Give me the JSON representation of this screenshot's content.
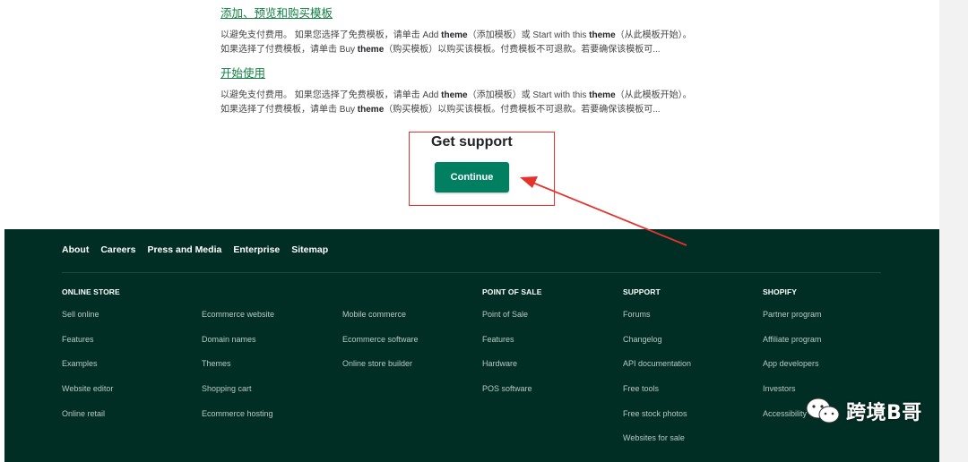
{
  "articles": [
    {
      "link": "添加、预览和购买模板",
      "line1_pre": "以避免支付费用。 如果您选择了免费模板，请单击 Add ",
      "line1_bold1": "theme",
      "line1_mid": "（添加模板）或 Start with this ",
      "line1_bold2": "theme",
      "line1_post": "（从此模板开始）。",
      "line2_pre": "如果选择了付费模板，请单击 Buy ",
      "line2_bold": "theme",
      "line2_post": "（购买模板）以购买该模板。付费模板不可退款。若要确保该模板可..."
    },
    {
      "link": "开始使用",
      "line1_pre": "以避免支付费用。 如果您选择了免费模板，请单击 Add ",
      "line1_bold1": "theme",
      "line1_mid": "（添加模板）或 Start with this ",
      "line1_bold2": "theme",
      "line1_post": "（从此模板开始）。",
      "line2_pre": "如果选择了付费模板，请单击 Buy ",
      "line2_bold": "theme",
      "line2_post": "（购买模板）以购买该模板。付费模板不可退款。若要确保该模板可..."
    }
  ],
  "support": {
    "title": "Get support",
    "button": "Continue"
  },
  "footer": {
    "top_links": [
      "About",
      "Careers",
      "Press and Media",
      "Enterprise",
      "Sitemap"
    ],
    "columns": [
      {
        "heading": "ONLINE STORE",
        "items": [
          "Sell online",
          "Features",
          "Examples",
          "Website editor",
          "Online retail"
        ]
      },
      {
        "heading": "",
        "items": [
          "Ecommerce website",
          "Domain names",
          "Themes",
          "Shopping cart",
          "Ecommerce hosting"
        ]
      },
      {
        "heading": "",
        "items": [
          "Mobile commerce",
          "Ecommerce software",
          "Online store builder"
        ]
      },
      {
        "heading": "POINT OF SALE",
        "items": [
          "Point of Sale",
          "Features",
          "Hardware",
          "POS software"
        ]
      },
      {
        "heading": "SUPPORT",
        "items": [
          "Forums",
          "Changelog",
          "API documentation",
          "Free tools",
          "Free stock photos",
          "Websites for sale"
        ]
      },
      {
        "heading": "SHOPIFY",
        "items": [
          "Partner program",
          "Affiliate program",
          "App developers",
          "Investors",
          "Accessibility"
        ]
      }
    ]
  },
  "watermark": {
    "text": "跨境B哥"
  },
  "colors": {
    "accent": "#008060",
    "link": "#108043",
    "footer_bg": "#002e25",
    "annotation": "#e5322d"
  },
  "icons": {
    "watermark_icon": "wechat-icon",
    "annotation_arrow": "arrow-icon"
  }
}
